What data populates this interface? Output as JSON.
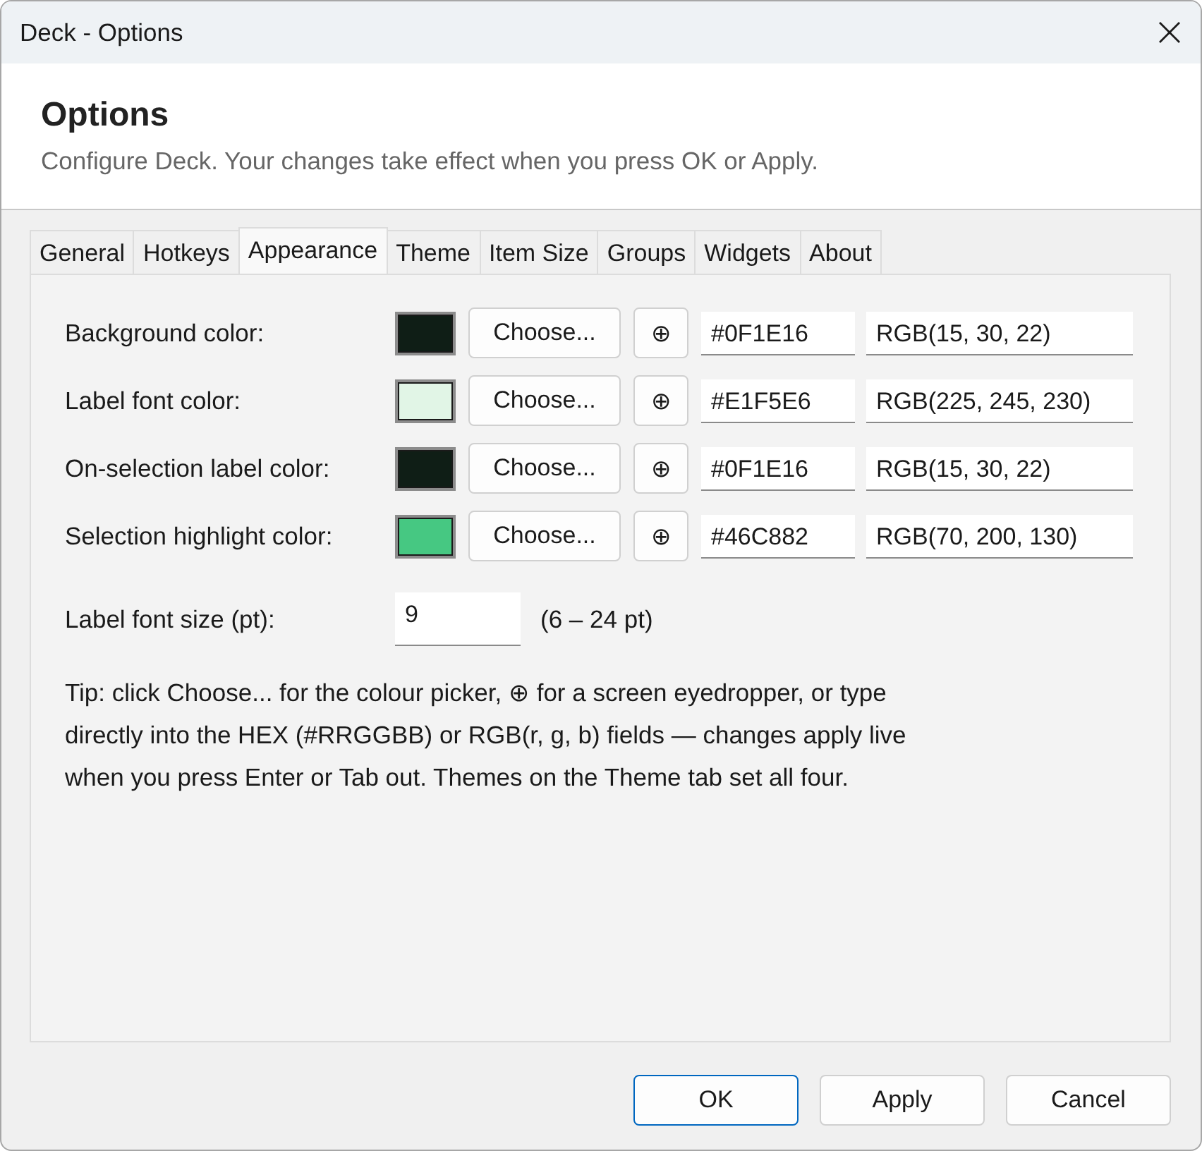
{
  "window": {
    "title": "Deck - Options"
  },
  "header": {
    "title": "Options",
    "subtitle": "Configure Deck. Your changes take effect when you press OK or Apply."
  },
  "tabs": [
    {
      "label": "General",
      "selected": false
    },
    {
      "label": "Hotkeys",
      "selected": false
    },
    {
      "label": "Appearance",
      "selected": true
    },
    {
      "label": "Theme",
      "selected": false
    },
    {
      "label": "Item Size",
      "selected": false
    },
    {
      "label": "Groups",
      "selected": false
    },
    {
      "label": "Widgets",
      "selected": false
    },
    {
      "label": "About",
      "selected": false
    }
  ],
  "color_rows": [
    {
      "label": "Background color:",
      "color": "#0f1e16",
      "choose_button": "Choose...",
      "eyedropper_button": "⊕",
      "hex": "#0F1E16",
      "rgb": "RGB(15, 30, 22)"
    },
    {
      "label": "Label font color:",
      "color": "#e1f5e6",
      "choose_button": "Choose...",
      "eyedropper_button": "⊕",
      "hex": "#E1F5E6",
      "rgb": "RGB(225, 245, 230)"
    },
    {
      "label": "On-selection label color:",
      "color": "#0f1e16",
      "choose_button": "Choose...",
      "eyedropper_button": "⊕",
      "hex": "#0F1E16",
      "rgb": "RGB(15, 30, 22)"
    },
    {
      "label": "Selection highlight color:",
      "color": "#46c882",
      "choose_button": "Choose...",
      "eyedropper_button": "⊕",
      "hex": "#46C882",
      "rgb": "RGB(70, 200, 130)"
    }
  ],
  "font_size": {
    "label": "Label font size (pt):",
    "value": "9",
    "range": "(6 – 24 pt)"
  },
  "tip": "Tip: click Choose... for the colour picker, ⊕ for a screen eyedropper, or type directly into the HEX (#RRGGBB) or RGB(r, g, b) fields — changes apply live when you press Enter or Tab out. Themes on the Theme tab set all four.",
  "buttons": [
    {
      "label": "OK",
      "default": true
    },
    {
      "label": "Apply",
      "default": false
    },
    {
      "label": "Cancel",
      "default": false
    }
  ]
}
